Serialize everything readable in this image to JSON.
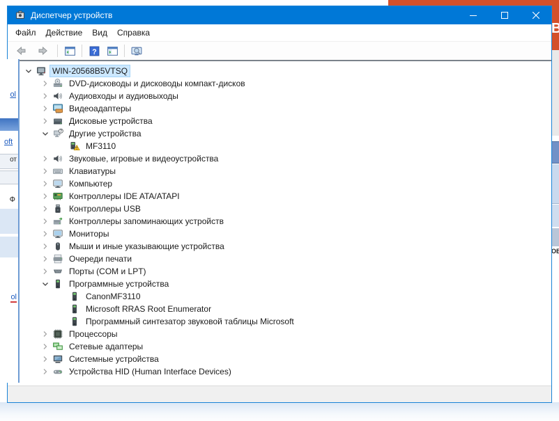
{
  "window": {
    "title": "Диспетчер устройств",
    "controls": [
      {
        "name": "minimize"
      },
      {
        "name": "maximize"
      },
      {
        "name": "close"
      }
    ]
  },
  "menu": {
    "items": [
      {
        "label": "Файл"
      },
      {
        "label": "Действие"
      },
      {
        "label": "Вид"
      },
      {
        "label": "Справка"
      }
    ]
  },
  "toolbar": {
    "buttons": [
      {
        "name": "back"
      },
      {
        "name": "forward"
      },
      {
        "name": "show-console-tree"
      },
      {
        "name": "help"
      },
      {
        "name": "show-action-pane"
      },
      {
        "name": "scan-hardware-changes"
      }
    ]
  },
  "tree": {
    "items": [
      {
        "label": "WIN-20568B5VTSQ",
        "level": 0,
        "state": "expanded",
        "icon": "computer-icon",
        "selected": true
      },
      {
        "label": "DVD-дисководы и дисководы компакт-дисков",
        "level": 1,
        "state": "collapsed",
        "icon": "dvd-drive-icon",
        "selected": false
      },
      {
        "label": "Аудиовходы и аудиовыходы",
        "level": 1,
        "state": "collapsed",
        "icon": "audio-icon",
        "selected": false
      },
      {
        "label": "Видеоадаптеры",
        "level": 1,
        "state": "collapsed",
        "icon": "display-adapter-icon",
        "selected": false
      },
      {
        "label": "Дисковые устройства",
        "level": 1,
        "state": "collapsed",
        "icon": "disk-drive-icon",
        "selected": false
      },
      {
        "label": "Другие устройства",
        "level": 1,
        "state": "expanded",
        "icon": "unknown-device-icon",
        "selected": false
      },
      {
        "label": "MF3110",
        "level": 2,
        "state": "leaf",
        "icon": "warning-device-icon",
        "selected": false
      },
      {
        "label": "Звуковые, игровые и видеоустройства",
        "level": 1,
        "state": "collapsed",
        "icon": "audio-icon",
        "selected": false
      },
      {
        "label": "Клавиатуры",
        "level": 1,
        "state": "collapsed",
        "icon": "keyboard-icon",
        "selected": false
      },
      {
        "label": "Компьютер",
        "level": 1,
        "state": "collapsed",
        "icon": "computer-monitor-icon",
        "selected": false
      },
      {
        "label": "Контроллеры IDE ATA/ATAPI",
        "level": 1,
        "state": "collapsed",
        "icon": "ide-controller-icon",
        "selected": false
      },
      {
        "label": "Контроллеры USB",
        "level": 1,
        "state": "collapsed",
        "icon": "usb-controller-icon",
        "selected": false
      },
      {
        "label": "Контроллеры запоминающих устройств",
        "level": 1,
        "state": "collapsed",
        "icon": "storage-controller-icon",
        "selected": false
      },
      {
        "label": "Мониторы",
        "level": 1,
        "state": "collapsed",
        "icon": "monitor-icon",
        "selected": false
      },
      {
        "label": "Мыши и иные указывающие устройства",
        "level": 1,
        "state": "collapsed",
        "icon": "mouse-icon",
        "selected": false
      },
      {
        "label": "Очереди печати",
        "level": 1,
        "state": "collapsed",
        "icon": "printer-icon",
        "selected": false
      },
      {
        "label": "Порты (COM и LPT)",
        "level": 1,
        "state": "collapsed",
        "icon": "ports-icon",
        "selected": false
      },
      {
        "label": "Программные устройства",
        "level": 1,
        "state": "expanded",
        "icon": "software-device-icon",
        "selected": false
      },
      {
        "label": "CanonMF3110",
        "level": 2,
        "state": "leaf",
        "icon": "software-device-icon",
        "selected": false
      },
      {
        "label": "Microsoft RRAS Root Enumerator",
        "level": 2,
        "state": "leaf",
        "icon": "software-device-icon",
        "selected": false
      },
      {
        "label": "Программный синтезатор звуковой таблицы Microsoft",
        "level": 2,
        "state": "leaf",
        "icon": "software-device-icon",
        "selected": false
      },
      {
        "label": "Процессоры",
        "level": 1,
        "state": "collapsed",
        "icon": "processor-icon",
        "selected": false
      },
      {
        "label": "Сетевые адаптеры",
        "level": 1,
        "state": "collapsed",
        "icon": "network-adapter-icon",
        "selected": false
      },
      {
        "label": "Системные устройства",
        "level": 1,
        "state": "collapsed",
        "icon": "system-device-icon",
        "selected": false
      },
      {
        "label": "Устройства HID (Human Interface Devices)",
        "level": 1,
        "state": "collapsed",
        "icon": "hid-device-icon",
        "selected": false
      }
    ]
  },
  "background": {
    "left_window_fragments": [
      {
        "text": "ol"
      },
      {
        "text": "oft"
      },
      {
        "text": "от"
      },
      {
        "text": "Ф"
      },
      {
        "text": "ol"
      }
    ],
    "right_edge_fragment": "ОВ",
    "top_letter_fragment": "B"
  },
  "colors": {
    "titlebar_blue": "#0078d7",
    "selection_blue": "#cce8ff",
    "warning_yellow": "#fdc22d",
    "background_orange": "#d4502a"
  }
}
